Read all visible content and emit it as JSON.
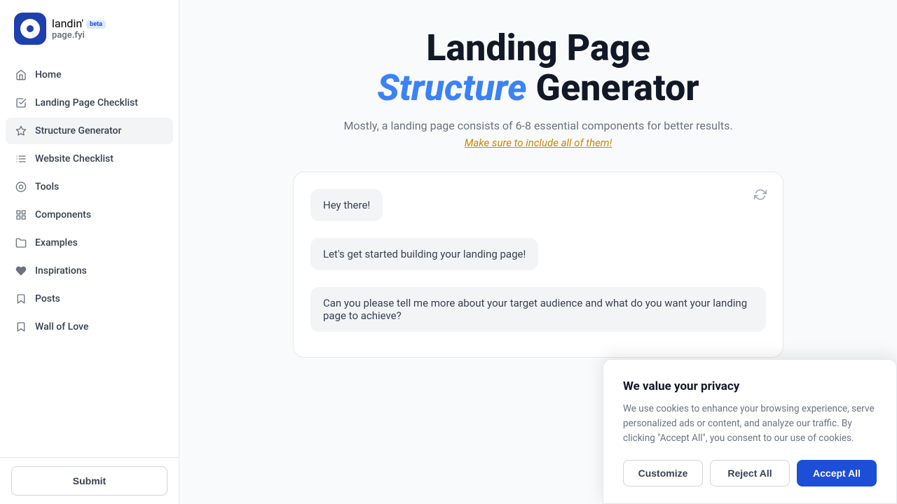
{
  "sidebar": {
    "logo": {
      "main": "landin'",
      "sub": "page.fyi",
      "beta": "beta"
    },
    "nav_items": [
      {
        "id": "home",
        "label": "Home",
        "icon": "🏠"
      },
      {
        "id": "checklist",
        "label": "Landing Page Checklist",
        "icon": "✅"
      },
      {
        "id": "structure",
        "label": "Structure Generator",
        "icon": "🔷"
      },
      {
        "id": "website-checklist",
        "label": "Website Checklist",
        "icon": "☰"
      },
      {
        "id": "tools",
        "label": "Tools",
        "icon": "🎨"
      },
      {
        "id": "components",
        "label": "Components",
        "icon": "⊞"
      },
      {
        "id": "examples",
        "label": "Examples",
        "icon": "📁"
      },
      {
        "id": "inspirations",
        "label": "Inspirations",
        "icon": "♥"
      },
      {
        "id": "posts",
        "label": "Posts",
        "icon": "🔖"
      },
      {
        "id": "wall-of-love",
        "label": "Wall of Love",
        "icon": "🔖"
      }
    ],
    "submit_label": "Submit"
  },
  "main": {
    "heading_line1": "Landing Page",
    "heading_line2_italic": "Structure",
    "heading_line2_rest": " Generator",
    "subtitle": "Mostly, a landing page consists of 6-8 essential components for better results.",
    "subtitle_cta": "Make sure to include all of them!",
    "chat": {
      "bubble1": "Hey there!",
      "bubble2": "Let's get started building your landing page!",
      "bubble3": "Can you please tell me more about your target audience and what do you want your landing page to achieve?"
    }
  },
  "cookie_banner": {
    "title": "We value your privacy",
    "body": "We use cookies to enhance your browsing experience, serve personalized ads or content, and analyze our traffic. By clicking \"Accept All\", you consent to our use of cookies.",
    "customize_label": "Customize",
    "reject_label": "Reject All",
    "accept_label": "Accept All"
  }
}
